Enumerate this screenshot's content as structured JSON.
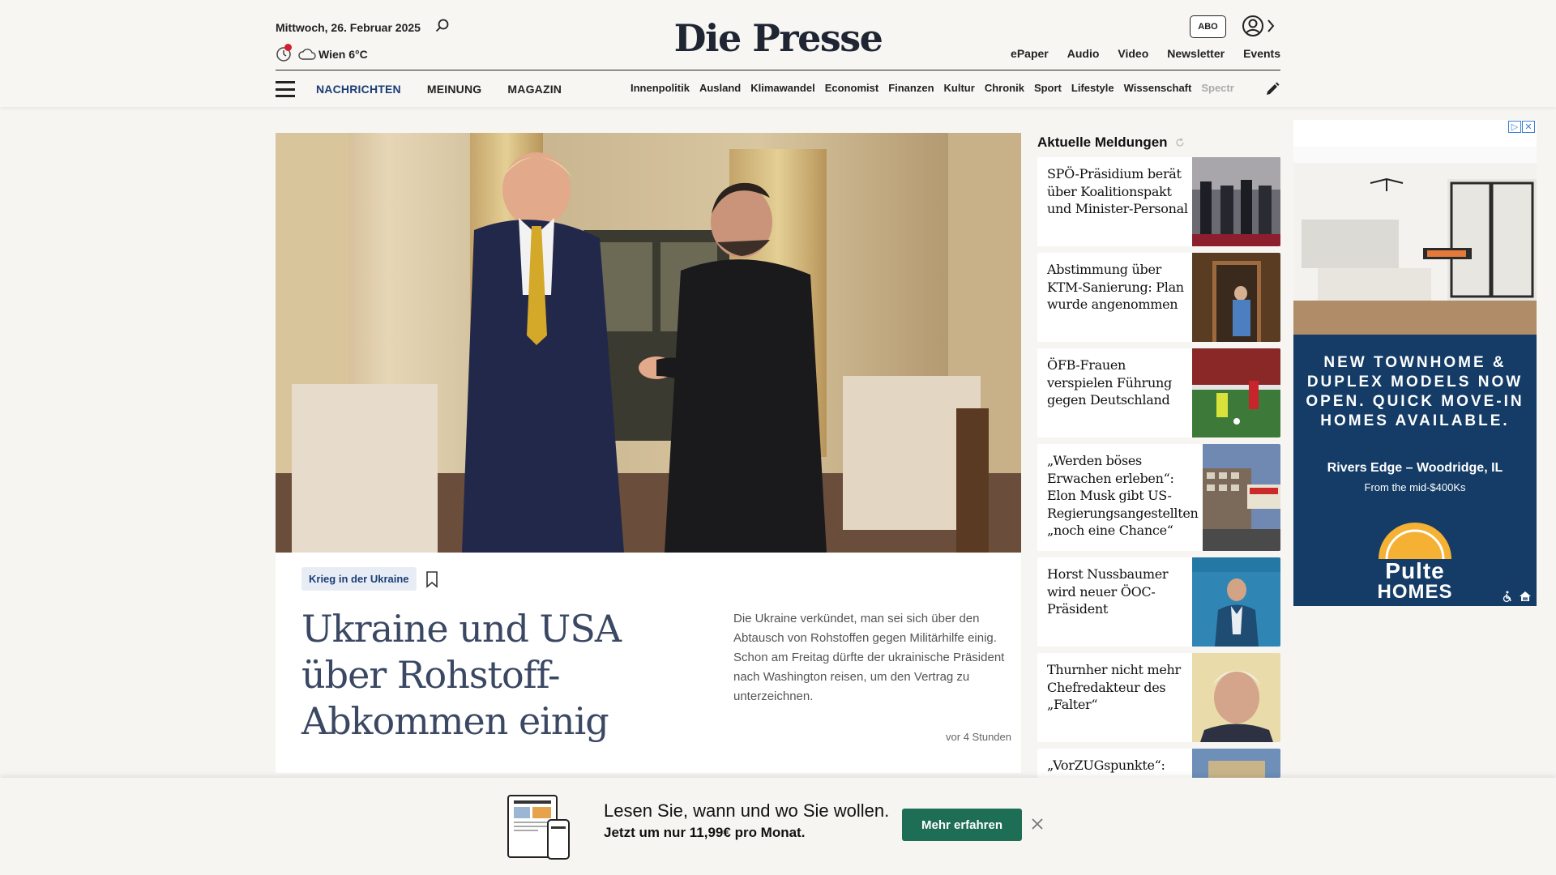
{
  "header": {
    "date": "Mittwoch, 26. Februar 2025",
    "weather": "Wien 6°C",
    "logo": "Die Presse",
    "abo_label": "ABO",
    "top_links": [
      "ePaper",
      "Audio",
      "Video",
      "Newsletter",
      "Events"
    ],
    "main_nav": [
      "NACHRICHTEN",
      "MEINUNG",
      "MAGAZIN"
    ],
    "sub_nav": [
      "Innenpolitik",
      "Ausland",
      "Klimawandel",
      "Economist",
      "Finanzen",
      "Kultur",
      "Chronik",
      "Sport",
      "Lifestyle",
      "Wissenschaft",
      "Spectr"
    ]
  },
  "hero": {
    "topic": "Krieg in der Ukraine",
    "headline": "Ukraine und USA über Rohstoff-Abkommen einig",
    "teaser": "Die Ukraine verkündet, man sei sich über den Abtausch von Rohstoffen gegen Militärhilfe einig. Schon am Freitag dürfte der ukrainische Präsident nach Washington reisen, um den Vertrag zu unterzeichnen.",
    "time": "vor 4 Stunden"
  },
  "sidebar": {
    "title": "Aktuelle Meldungen",
    "items": [
      {
        "text": "SPÖ-Präsidium berät über Koalitionspakt und Minister-Personal"
      },
      {
        "text": "Abstimmung über KTM-Sanierung: Plan wurde angenommen"
      },
      {
        "text": "ÖFB-Frauen verspielen Führung gegen Deutschland"
      },
      {
        "text": "„Werden böses Erwachen erleben“: Elon Musk gibt US-Regierungsangestellten „noch eine Chance“"
      },
      {
        "text": "Horst Nussbaumer wird neuer ÖOC-Präsident"
      },
      {
        "text": "Thurnher nicht mehr Chefredakteur des „Falter“"
      },
      {
        "text": "„VorZUGspunkte“:"
      }
    ]
  },
  "ad": {
    "headline": "NEW TOWNHOME & DUPLEX MODELS NOW OPEN. QUICK MOVE-IN HOMES AVAILABLE.",
    "location": "Rivers Edge – Woodridge, IL",
    "price": "From the mid-$400Ks",
    "brand_line1": "Pulte",
    "brand_line2": "HOMES"
  },
  "banner": {
    "title": "Lesen Sie, wann und wo Sie wollen.",
    "subtitle": "Jetzt um nur 11,99€ pro Monat.",
    "button": "Mehr erfahren"
  }
}
